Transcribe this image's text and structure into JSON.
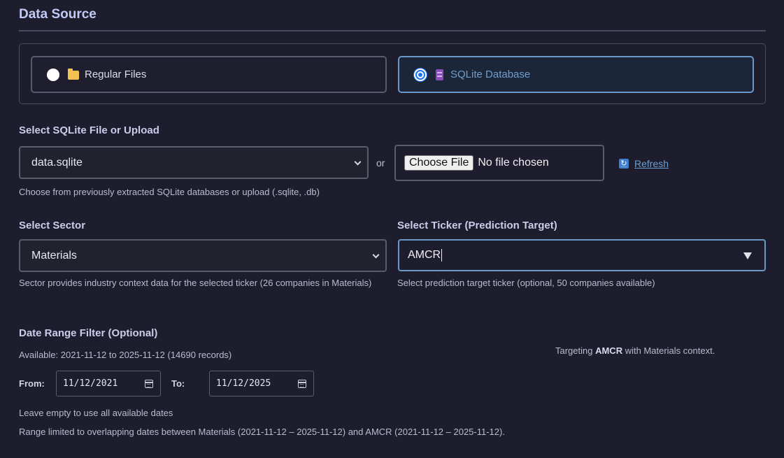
{
  "section": {
    "title": "Data Source"
  },
  "source_options": {
    "regular": {
      "label": "Regular Files",
      "icon": "folder-icon",
      "selected": false
    },
    "sqlite": {
      "label": "SQLite Database",
      "icon": "database-icon",
      "selected": true
    }
  },
  "sqlite_file": {
    "label": "Select SQLite File or Upload",
    "selected_value": "data.sqlite",
    "or_text": "or",
    "choose_file_label": "Choose File",
    "file_status": "No file chosen",
    "refresh_label": "Refresh",
    "hint": "Choose from previously extracted SQLite databases or upload (.sqlite, .db)"
  },
  "sector": {
    "label": "Select Sector",
    "selected_value": "Materials",
    "hint": "Sector provides industry context data for the selected ticker (26 companies in Materials)"
  },
  "ticker": {
    "label": "Select Ticker (Prediction Target)",
    "value": "AMCR",
    "hint": "Select prediction target ticker (optional, 50 companies available)"
  },
  "date_range": {
    "label": "Date Range Filter (Optional)",
    "available": "Available: 2021-11-12 to 2025-11-12 (14690 records)",
    "from_label": "From:",
    "from_value": "11/12/2021",
    "to_label": "To:",
    "to_value": "11/12/2025",
    "empty_hint": "Leave empty to use all available dates",
    "range_note": "Range limited to overlapping dates between Materials (2021-11-12 – 2025-11-12) and AMCR (2021-11-12 – 2025-11-12)."
  },
  "targeting": {
    "prefix": "Targeting ",
    "ticker": "AMCR",
    "suffix": " with Materials context."
  },
  "colors": {
    "background": "#1e1d2d",
    "accent": "#6f9ed0",
    "selected_border": "#6a98c8",
    "radio_selected": "#1a74e8"
  }
}
